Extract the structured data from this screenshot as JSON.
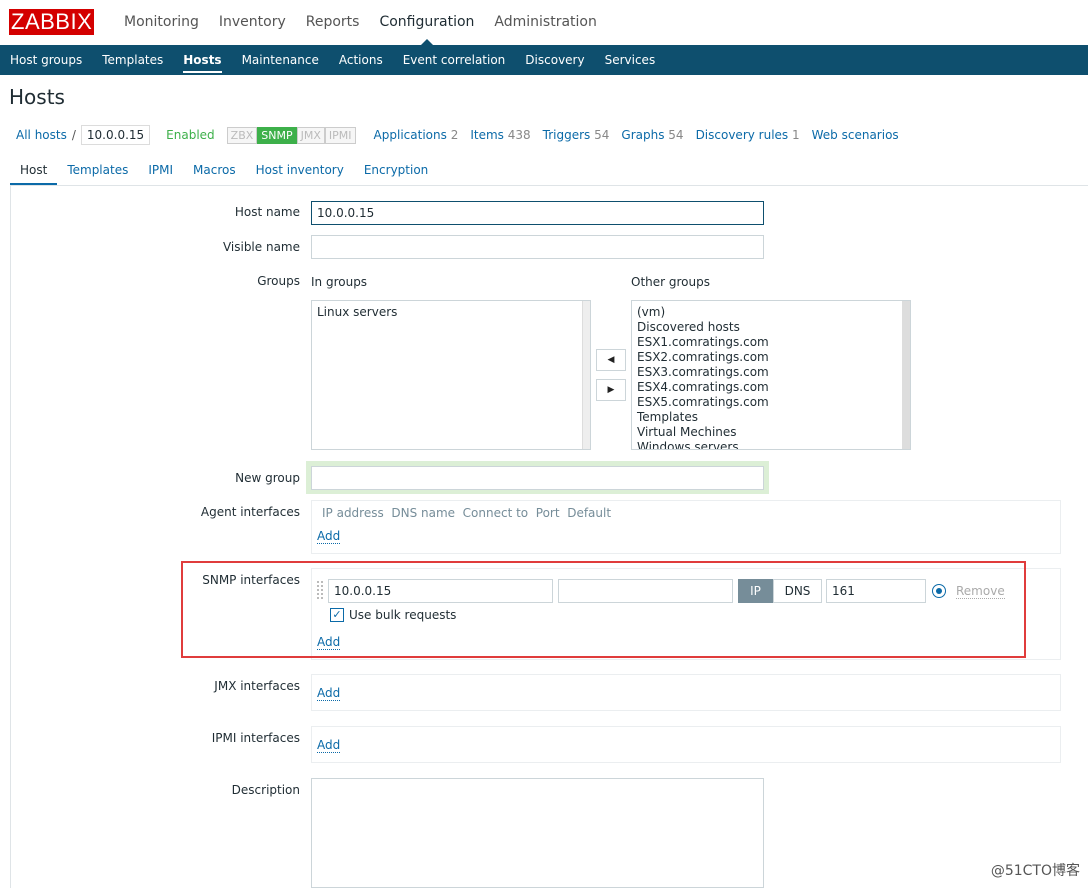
{
  "logo": "ZABBIX",
  "main_menu": [
    "Monitoring",
    "Inventory",
    "Reports",
    "Configuration",
    "Administration"
  ],
  "sub_menu": [
    "Host groups",
    "Templates",
    "Hosts",
    "Maintenance",
    "Actions",
    "Event correlation",
    "Discovery",
    "Services"
  ],
  "page_title": "Hosts",
  "breadcrumb": {
    "all_hosts": "All hosts",
    "sep": "/",
    "host": "10.0.0.15"
  },
  "status": "Enabled",
  "availability": [
    "ZBX",
    "SNMP",
    "JMX",
    "IPMI"
  ],
  "nav_links": [
    {
      "label": "Applications",
      "count": "2"
    },
    {
      "label": "Items",
      "count": "438"
    },
    {
      "label": "Triggers",
      "count": "54"
    },
    {
      "label": "Graphs",
      "count": "54"
    },
    {
      "label": "Discovery rules",
      "count": "1"
    },
    {
      "label": "Web scenarios",
      "count": ""
    }
  ],
  "tabs": [
    "Host",
    "Templates",
    "IPMI",
    "Macros",
    "Host inventory",
    "Encryption"
  ],
  "form": {
    "host_name_label": "Host name",
    "host_name_value": "10.0.0.15",
    "visible_name_label": "Visible name",
    "visible_name_value": "",
    "groups_label": "Groups",
    "in_groups_label": "In groups",
    "other_groups_label": "Other groups",
    "in_groups": [
      "Linux servers"
    ],
    "other_groups": [
      "(vm)",
      "Discovered hosts",
      "ESX1.comratings.com",
      "ESX2.comratings.com",
      "ESX3.comratings.com",
      "ESX4.comratings.com",
      "ESX5.comratings.com",
      "Templates",
      "Virtual Mechines",
      "Windows servers"
    ],
    "new_group_label": "New group",
    "new_group_value": "",
    "agent_label": "Agent interfaces",
    "agent_headers": "IP address  DNS name  Connect to  Port  Default",
    "add": "Add",
    "snmp_label": "SNMP interfaces",
    "snmp_ip": "10.0.0.15",
    "snmp_dns": "",
    "snmp_ip_btn": "IP",
    "snmp_dns_btn": "DNS",
    "snmp_port": "161",
    "remove": "Remove",
    "bulk_label": "Use bulk requests",
    "bulk_checked": true,
    "jmx_label": "JMX interfaces",
    "ipmi_label": "IPMI interfaces",
    "description_label": "Description"
  },
  "watermark": "@51CTO博客"
}
